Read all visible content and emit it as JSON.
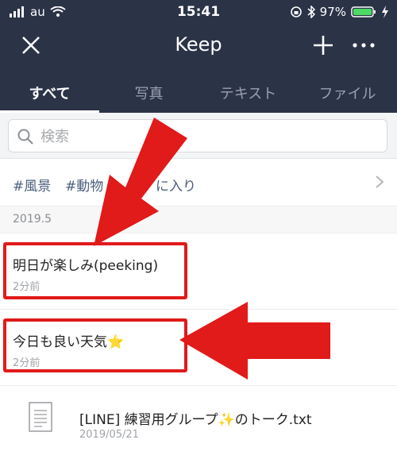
{
  "status": {
    "carrier": "au",
    "time": "15:41",
    "battery": "97%"
  },
  "titlebar": {
    "title": "Keep"
  },
  "tabs": [
    {
      "label": "すべて",
      "active": true
    },
    {
      "label": "写真"
    },
    {
      "label": "テキスト"
    },
    {
      "label": "ファイル"
    }
  ],
  "search": {
    "placeholder": "検索"
  },
  "tags": [
    {
      "label": "#風景"
    },
    {
      "label": "#動物"
    },
    {
      "label": "に入り"
    }
  ],
  "section": {
    "date": "2019.5"
  },
  "items": [
    {
      "text": "明日が楽しみ(peeking)",
      "time": "2分前"
    },
    {
      "text": "今日も良い天気⭐",
      "time": "2分前"
    },
    {
      "text": "[LINE] 練習用グループ✨のトーク.txt",
      "time": "2019/05/21"
    }
  ],
  "colors": {
    "header_bg": "#2b3347",
    "highlight_red": "#e11a1a",
    "battery_green": "#4cd964"
  }
}
